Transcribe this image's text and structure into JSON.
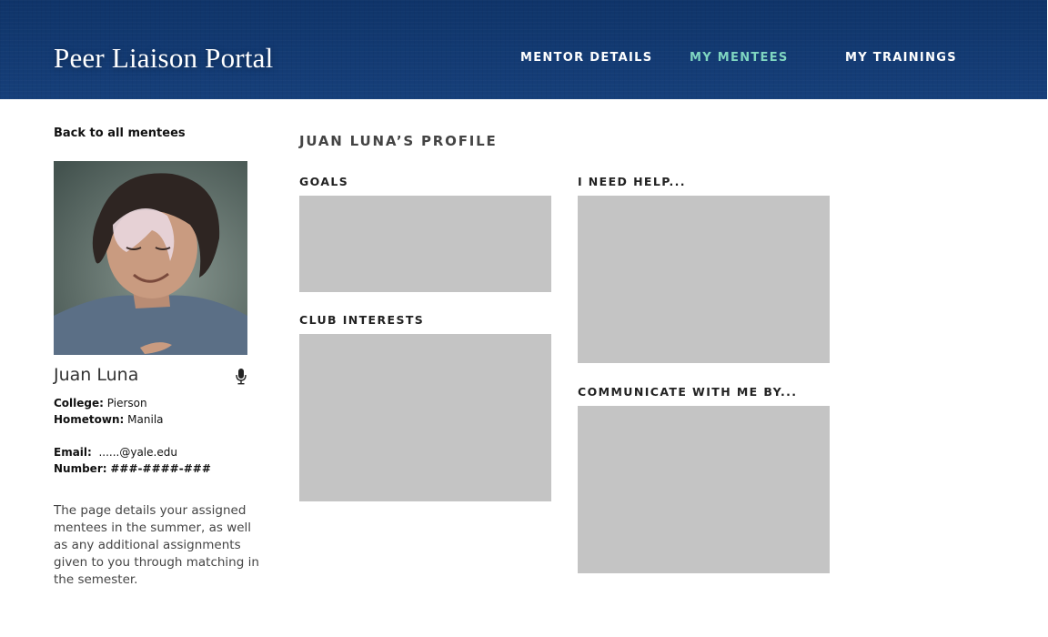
{
  "header": {
    "brand": "Peer Liaison Portal",
    "nav": [
      {
        "label": "MENTOR DETAILS",
        "active": false
      },
      {
        "label": "MY MENTEES",
        "active": true
      },
      {
        "label": "MY TRAININGS",
        "active": false
      }
    ],
    "active_color": "#7fd6c1"
  },
  "sidebar": {
    "back_link": "Back to all mentees",
    "mentee_name": "Juan Luna",
    "college_label": "College:",
    "college_value": "Pierson",
    "hometown_label": "Hometown:",
    "hometown_value": "Manila",
    "email_label": "Email:",
    "email_value": "......@yale.edu",
    "number_label": "Number:",
    "number_value": "###-####-###",
    "description": "The page details your assigned mentees in the summer, as well as any additional assignments given to you through matching in the semester."
  },
  "profile": {
    "title": "JUAN LUNA’S PROFILE",
    "sections": {
      "goals": "GOALS",
      "club_interests": "CLUB INTERESTS",
      "need_help": "I NEED HELP...",
      "communicate": "COMMUNICATE WITH ME BY..."
    }
  },
  "icons": {
    "mic": "microphone-icon",
    "photo": "profile-photo"
  }
}
